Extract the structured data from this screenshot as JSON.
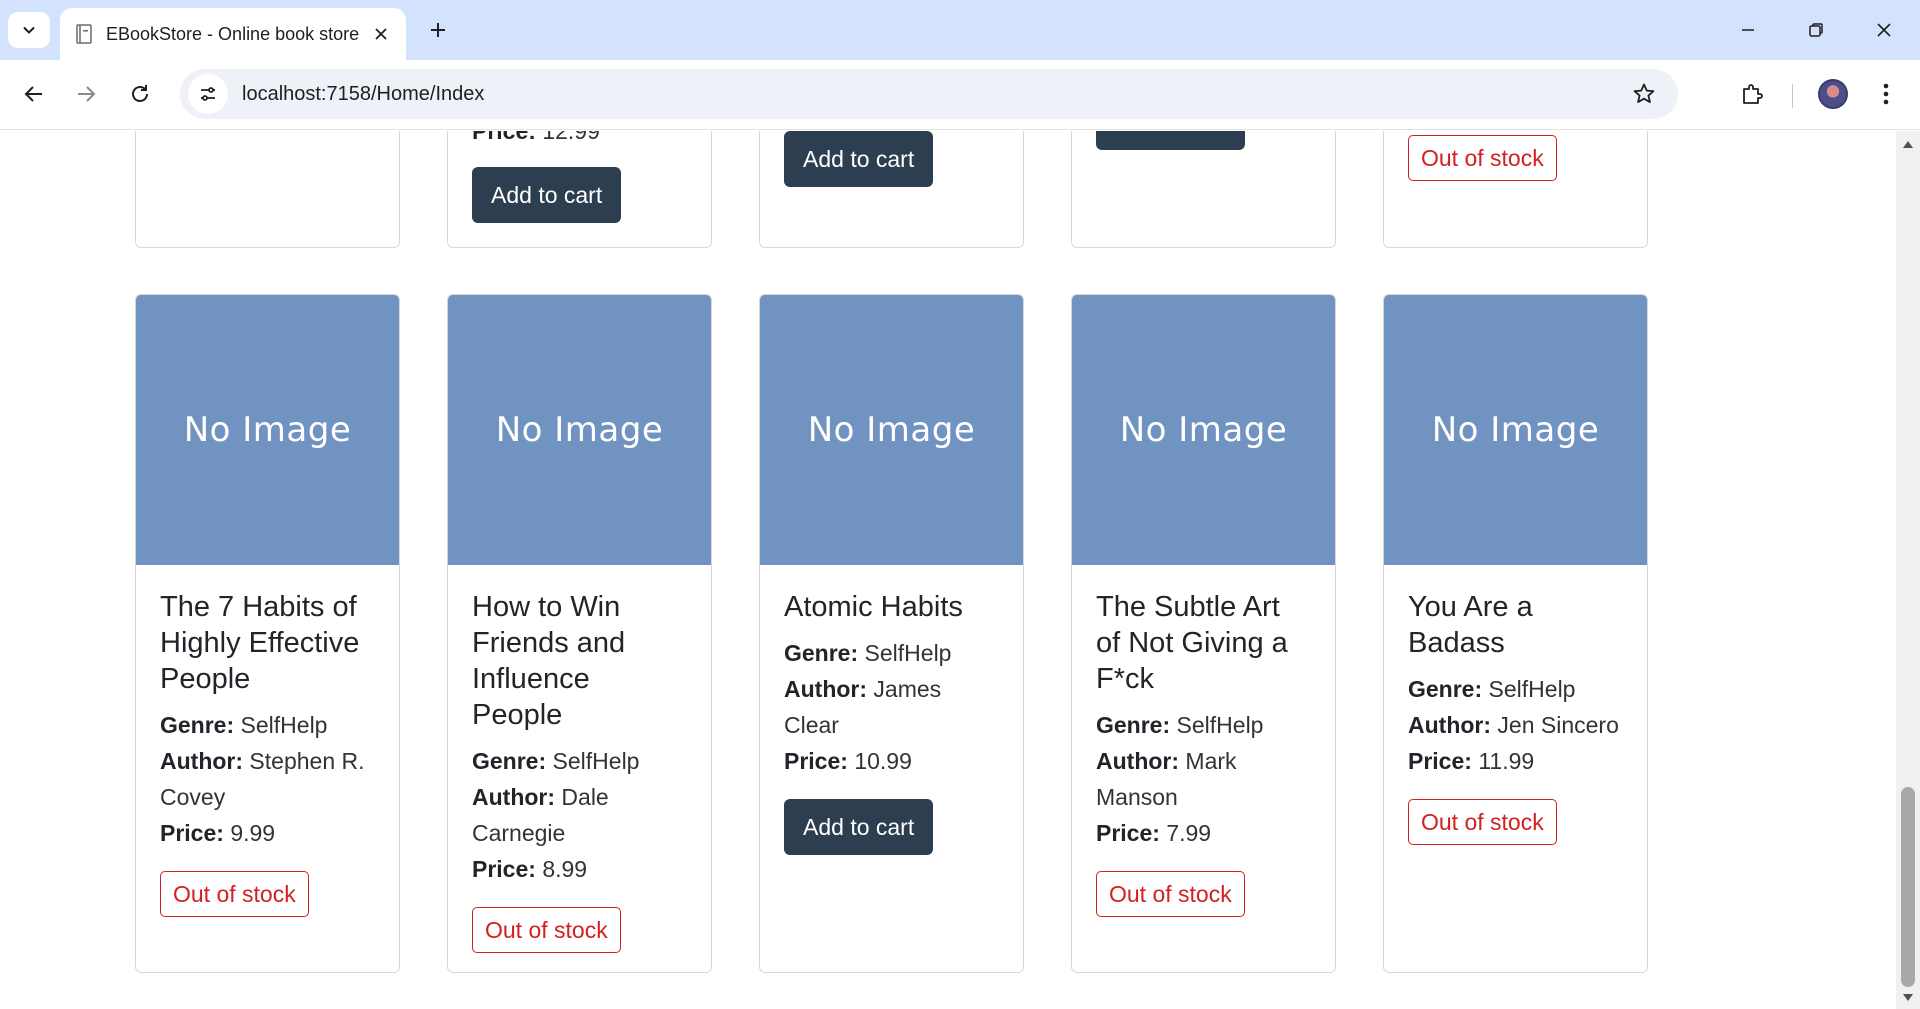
{
  "browser": {
    "tab_title": "EBookStore - Online book store",
    "url": "localhost:7158/Home/Index"
  },
  "labels": {
    "no_image": "No Image",
    "genre": "Genre:",
    "author": "Author:",
    "price": "Price:",
    "add_to_cart": "Add to cart",
    "out_of_stock": "Out of stock"
  },
  "top_row": {
    "card2_price": "12.99"
  },
  "books": [
    {
      "title": "The 7 Habits of Highly Effective People",
      "genre": "SelfHelp",
      "author": "Stephen R. Covey",
      "price": "9.99",
      "in_stock": false
    },
    {
      "title": "How to Win Friends and Influence People",
      "genre": "SelfHelp",
      "author": "Dale Carnegie",
      "price": "8.99",
      "in_stock": false
    },
    {
      "title": "Atomic Habits",
      "genre": "SelfHelp",
      "author": "James Clear",
      "price": "10.99",
      "in_stock": true
    },
    {
      "title": "The Subtle Art of Not Giving a F*ck",
      "genre": "SelfHelp",
      "author": "Mark Manson",
      "price": "7.99",
      "in_stock": false
    },
    {
      "title": "You Are a Badass",
      "genre": "SelfHelp",
      "author": "Jen Sincero",
      "price": "11.99",
      "in_stock": false
    }
  ],
  "colors": {
    "placeholder_bg": "#7193c1",
    "cart_button": "#2c3e50",
    "out_of_stock": "#d21f1f"
  }
}
